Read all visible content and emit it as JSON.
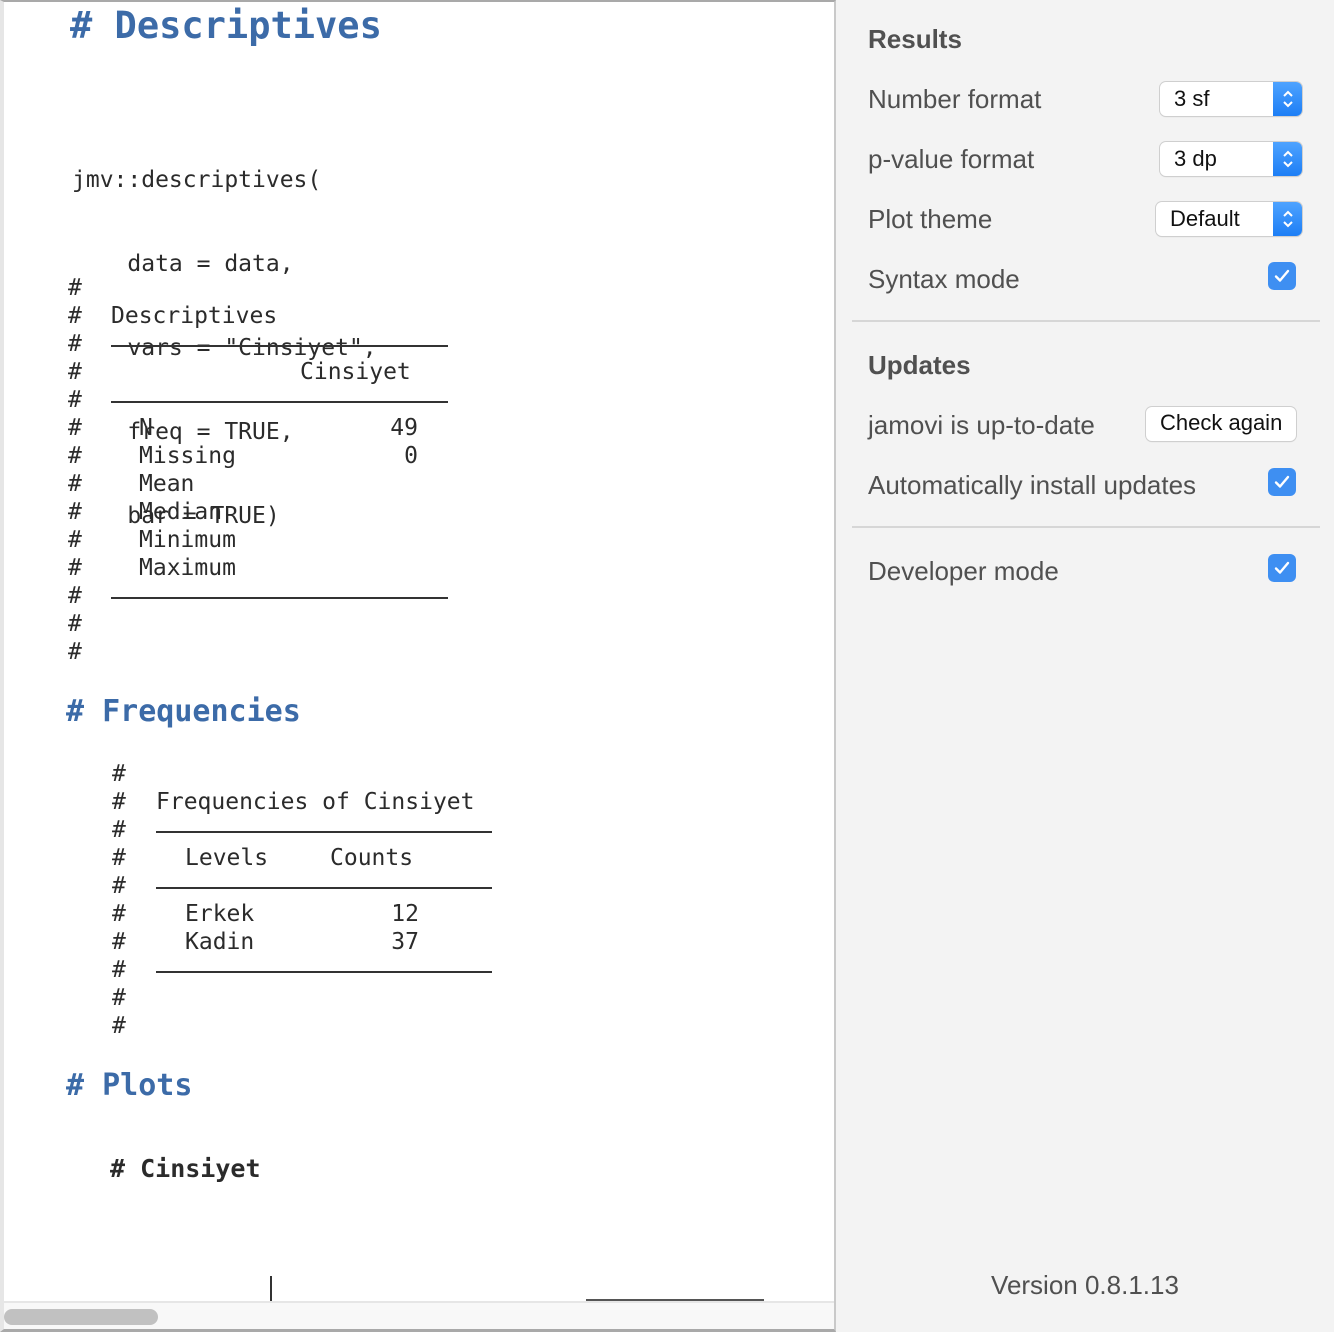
{
  "results": {
    "title": "# Descriptives",
    "code_lines": [
      "jmv::descriptives(",
      "    data = data,",
      "    vars = \"Cinsiyet\",",
      "    freq = TRUE,",
      "    bar = TRUE)"
    ],
    "descriptives_table": {
      "title": "Descriptives",
      "column_header": "Cinsiyet",
      "rows": [
        {
          "label": "N",
          "value": "49"
        },
        {
          "label": "Missing",
          "value": "0"
        },
        {
          "label": "Mean",
          "value": ""
        },
        {
          "label": "Median",
          "value": ""
        },
        {
          "label": "Minimum",
          "value": ""
        },
        {
          "label": "Maximum",
          "value": ""
        }
      ]
    },
    "frequencies_heading": "# Frequencies",
    "frequencies_table": {
      "title": "Frequencies of Cinsiyet",
      "headers": [
        "Levels",
        "Counts"
      ],
      "rows": [
        {
          "level": "Erkek",
          "count": "12"
        },
        {
          "level": "Kadin",
          "count": "37"
        }
      ]
    },
    "plots_heading": "# Plots",
    "plot_subheading": "# Cinsiyet",
    "hash": "#"
  },
  "settings": {
    "results_section": {
      "title": "Results",
      "number_format": {
        "label": "Number format",
        "value": "3 sf"
      },
      "pvalue_format": {
        "label": "p-value format",
        "value": "3 dp"
      },
      "plot_theme": {
        "label": "Plot theme",
        "value": "Default"
      },
      "syntax_mode": {
        "label": "Syntax mode",
        "checked": true
      }
    },
    "updates_section": {
      "title": "Updates",
      "status": "jamovi is up-to-date",
      "check_button": "Check again",
      "auto_install": {
        "label": "Automatically install updates",
        "checked": true
      }
    },
    "developer_mode": {
      "label": "Developer mode",
      "checked": true
    },
    "version": "Version 0.8.1.13"
  },
  "colors": {
    "heading_blue": "#3c6ba8",
    "accent_blue": "#3e8ff2"
  }
}
